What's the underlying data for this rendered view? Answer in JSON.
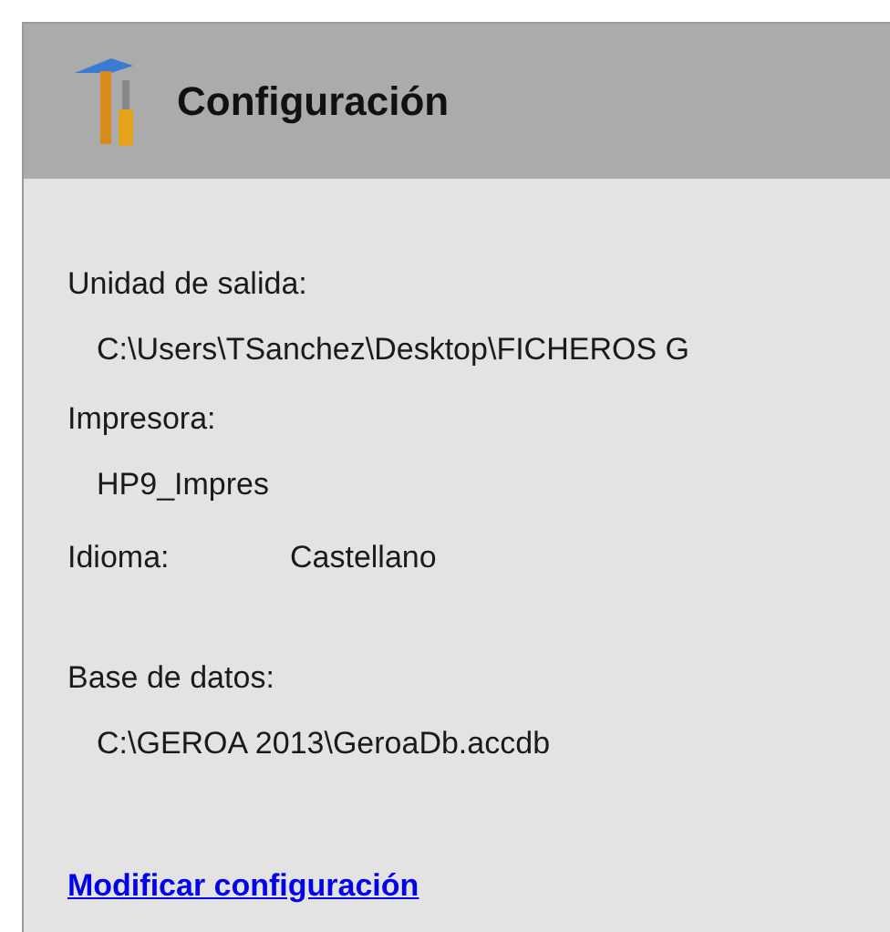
{
  "header": {
    "title": "Configuración"
  },
  "output_unit": {
    "label": "Unidad de salida:",
    "value": "C:\\Users\\TSanchez\\Desktop\\FICHEROS G"
  },
  "printer": {
    "label": "Impresora:",
    "value": "HP9_Impres"
  },
  "language": {
    "label": "Idioma:",
    "value": "Castellano"
  },
  "database": {
    "label": "Base de datos:",
    "value": "C:\\GEROA 2013\\GeroaDb.accdb"
  },
  "link": "Modificar configuración"
}
